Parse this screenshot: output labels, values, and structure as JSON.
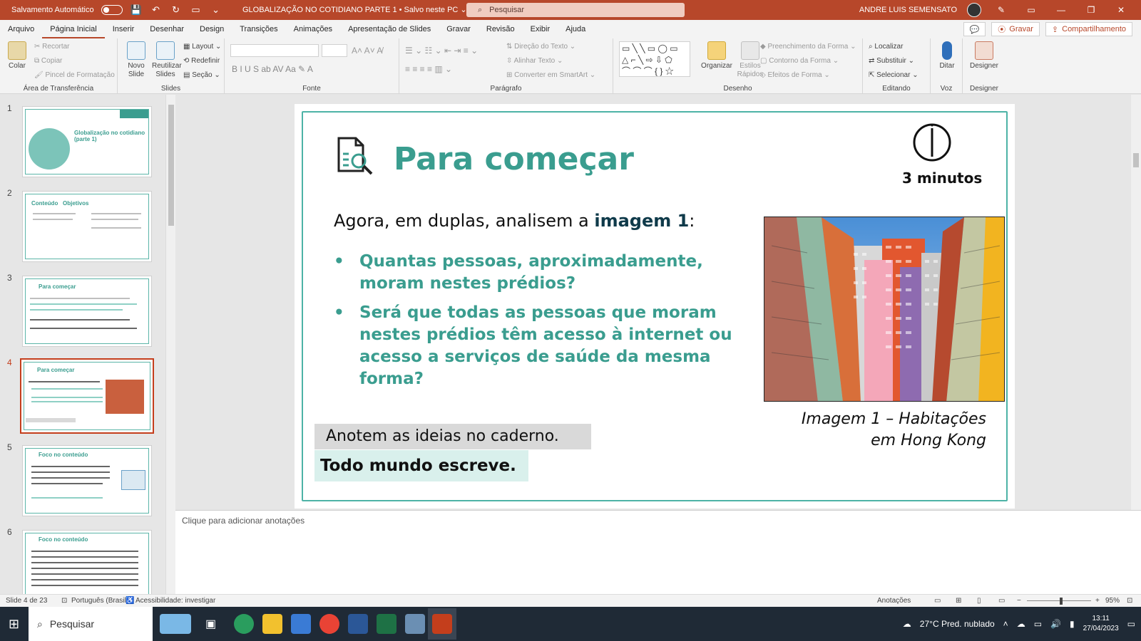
{
  "titlebar": {
    "autosave_label": "Salvamento Automático",
    "doc_title": "GLOBALIZAÇÃO NO COTIDIANO PARTE 1 • Salvo neste PC ⌄",
    "search_placeholder": "Pesquisar",
    "user_name": "ANDRE LUIS SEMENSATO"
  },
  "tabs": [
    "Arquivo",
    "Página Inicial",
    "Inserir",
    "Desenhar",
    "Design",
    "Transições",
    "Animações",
    "Apresentação de Slides",
    "Gravar",
    "Revisão",
    "Exibir",
    "Ajuda"
  ],
  "tabs_right": {
    "record": "Gravar",
    "share": "Compartilhamento"
  },
  "ribbon": {
    "clipboard": {
      "label": "Área de Transferência",
      "paste": "Colar",
      "cut": "Recortar",
      "copy": "Copiar",
      "format_painter": "Pincel de Formatação"
    },
    "slides": {
      "label": "Slides",
      "new_slide": "Novo Slide",
      "reuse": "Reutilizar Slides",
      "layout": "Layout",
      "reset": "Redefinir",
      "section": "Seção"
    },
    "font": {
      "label": "Fonte"
    },
    "paragraph": {
      "label": "Parágrafo",
      "text_direction": "Direção do Texto",
      "align_text": "Alinhar Texto",
      "smartart": "Converter em SmartArt"
    },
    "drawing": {
      "label": "Desenho",
      "arrange": "Organizar",
      "quick_styles": "Estilos Rápidos",
      "fill": "Preenchimento da Forma",
      "outline": "Contorno da Forma",
      "effects": "Efeitos de Forma"
    },
    "editing": {
      "label": "Editando",
      "find": "Localizar",
      "replace": "Substituir",
      "select": "Selecionar"
    },
    "voice": {
      "label": "Voz",
      "dictate": "Ditar"
    },
    "designer": {
      "label": "Designer",
      "designer": "Designer"
    }
  },
  "thumbnails": [
    {
      "num": "1",
      "title": "Globalização no cotidiano (parte 1)"
    },
    {
      "num": "2",
      "title": "Conteúdo   Objetivos"
    },
    {
      "num": "3",
      "title": "Para começar"
    },
    {
      "num": "4",
      "title": "Para começar"
    },
    {
      "num": "5",
      "title": "Foco no conteúdo"
    },
    {
      "num": "6",
      "title": "Foco no conteúdo"
    }
  ],
  "slide": {
    "title": "Para começar",
    "timer": "3 minutos",
    "intro_prefix": "Agora, em duplas, analisem a ",
    "intro_bold": "imagem 1",
    "intro_suffix": ":",
    "bullets": [
      "Quantas pessoas, aproximadamente, moram nestes prédios?",
      "Será que todas as pessoas que moram nestes prédios têm acesso à internet ou acesso a serviços de saúde da mesma forma?"
    ],
    "caption_line1": "Imagem 1 – Habitações",
    "caption_line2": "em Hong Kong",
    "note1": "Anotem as ideias no caderno.",
    "note2": "Todo mundo escreve."
  },
  "notes_placeholder": "Clique para adicionar anotações",
  "status": {
    "slide_count": "Slide 4 de 23",
    "language": "Português (Brasil)",
    "accessibility": "Acessibilidade: investigar",
    "notes": "Anotações",
    "zoom": "95%"
  },
  "taskbar": {
    "search": "Pesquisar",
    "weather": "27°C  Pred. nublado",
    "time": "13:11",
    "date": "27/04/2023"
  },
  "colors": {
    "accent": "#b7472a",
    "teal": "#3a9d8f"
  }
}
